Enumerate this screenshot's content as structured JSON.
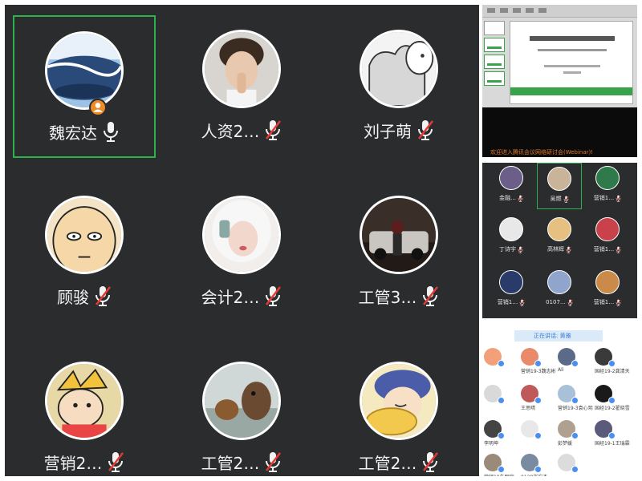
{
  "main_grid": {
    "tiles": [
      {
        "name": "魏宏达",
        "mic": "on",
        "host": true,
        "active": true,
        "avatar": "avatar-ocean"
      },
      {
        "name": "人资2…",
        "mic": "muted",
        "host": false,
        "active": false,
        "avatar": "avatar-boy-photo"
      },
      {
        "name": "刘子萌",
        "mic": "muted",
        "host": false,
        "active": false,
        "avatar": "avatar-paw-sketch"
      },
      {
        "name": "顾骏",
        "mic": "muted",
        "host": false,
        "active": false,
        "avatar": "avatar-bald-cartoon"
      },
      {
        "name": "会计2…",
        "mic": "muted",
        "host": false,
        "active": false,
        "avatar": "avatar-white-hair-girl"
      },
      {
        "name": "工管3…",
        "mic": "muted",
        "host": false,
        "active": false,
        "avatar": "avatar-car-night"
      },
      {
        "name": "营销2…",
        "mic": "muted",
        "host": false,
        "active": false,
        "avatar": "avatar-cartoon-kid"
      },
      {
        "name": "工管2…",
        "mic": "muted",
        "host": false,
        "active": false,
        "avatar": "avatar-cat-photo"
      },
      {
        "name": "工管2…",
        "mic": "muted",
        "host": false,
        "active": false,
        "avatar": "avatar-anime-boy"
      }
    ]
  },
  "slide_panel": {
    "caption": "欢迎进入腾讯会议网络研讨会(Webinar)!"
  },
  "mini_grid": {
    "tiles": [
      {
        "name": "金融…",
        "active": false
      },
      {
        "name": "吴燃",
        "active": true
      },
      {
        "name": "营销1…",
        "active": false
      },
      {
        "name": "丁诗宇",
        "active": false
      },
      {
        "name": "高林辉",
        "active": false
      },
      {
        "name": "营销1…",
        "active": false
      },
      {
        "name": "营销1…",
        "active": false
      },
      {
        "name": "0107…",
        "active": false
      },
      {
        "name": "营销1…",
        "active": false
      }
    ]
  },
  "list_panel": {
    "header": "正在讲话: 黄雅",
    "items": [
      {
        "name": ""
      },
      {
        "name": "营销19-3魏志彬"
      },
      {
        "name": "Ali"
      },
      {
        "name": "国经19-2龚清天"
      },
      {
        "name": ""
      },
      {
        "name": "王思晴"
      },
      {
        "name": "营销19-3袁心玥"
      },
      {
        "name": "国经19-2翟晓雪"
      },
      {
        "name": "李明坤"
      },
      {
        "name": ""
      },
      {
        "name": "彭梦媛"
      },
      {
        "name": "国经19-1王瑞霖"
      },
      {
        "name": "营销19朱明宇"
      },
      {
        "name": "0128张宏杰"
      },
      {
        "name": ""
      }
    ]
  },
  "colors": {
    "grid_bg": "#2b2c2e",
    "active_border": "#2bb24c",
    "host_badge": "#f08a24",
    "muted_slash": "#e53935",
    "list_badge": "#4a8ff0"
  }
}
